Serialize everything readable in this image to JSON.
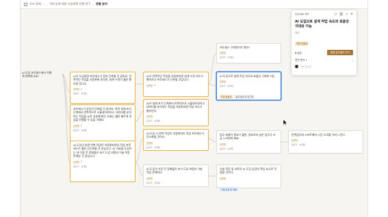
{
  "topbar": {
    "crumbs": [
      "조코 설계 ...",
      "AI도입에 대한 사업계획 진행 연구",
      "병렬 분석"
    ]
  },
  "nodes": {
    "n_left_cut": {
      "text": "AI 도입 프로세스에서 어떻\n게 변화하나요?"
    },
    "n1": {
      "text": "AI가 도입되면 프로세스가 점차 단축될 것 같아요. 반복적인 작업을 자동화해 준다면, 설계 수정이 훨씬 빨라질 겁니다.",
      "meta_a": "답변함",
      "meta_b": "2",
      "author": "응답자 · 설계팀"
    },
    "n2": {
      "text": "AI가 반복적인 작업을 자동화하면 설계 수정 속도가 빨라지고 프로세스가 단축될 것입니다.",
      "meta_a": "답변함",
      "meta_b": "2",
      "author": "응답자 · 설계팀"
    },
    "n3": {
      "text": "프로세스 구체적으로 뭐야?",
      "meta_a": "답변함",
      "author": "응답자 · 설계팀"
    },
    "n4": {
      "text": "AI 도입으로 설계 작업 속도와 효율성 극대화 가능",
      "meta_a": "답변함",
      "author": "응답자 · 설계팀",
      "chips": [
        "작업 효율성",
        "설계 변경 및 피드백"
      ]
    },
    "n5": {
      "text": "프로세스가 상당히 단축될 것 같아요. 특히 설계 초기 단계에서 반복적으로 시뮬레이션하고, 데이터를 분석하는 작업을 AI로 자동화하면, 지표는 훨씬 빠르게 작업을 진행할 수 있을 거예요.",
      "meta_a": "답변함",
      "meta_b": "2",
      "author": "응답자 · 설계팀"
    },
    "n6": {
      "text": "AI가 설계 초기 단계에서 반복적으로 시뮬레이션하고 데이터를 분석하는 작업을 자동화하면 작업 속도가 빨라진다.",
      "meta_a": "답변함",
      "author": "응답자 · 설계팀"
    },
    "n7": {
      "text": "AI 도입이 되면 반복 작업이 자동화되면서 작업 프로세스가 훨씬 간소화될 것 같습니다. AI 기술을 도입하는 데 가장 큰 장애물은 초기 도입 비용과 기술 적응 문제일 것 같습니다.",
      "meta_a": "답변함",
      "meta_b": "2",
      "author": "응답자 · 설계팀"
    },
    "n8": {
      "text": "AI 도입 시 반복 작업이 자동화되어 작업 프로세스가 간소화될 것이다.",
      "meta_a": "답변함",
      "author": "응답자 · 설계팀"
    },
    "n9": {
      "text": "업무 흐름이 필요가 줄면, 중요하지 않은 업무가 조금 느려지게 돼요.",
      "meta_a": "답변함",
      "author": "응답자 · 설계팀"
    },
    "n10": {
      "text": "반복업무에 소프트웨어 시간 소모를 가져 느린다.",
      "meta_a": "답변함",
      "author": "응답자 · 설계팀"
    },
    "n11": {
      "text": "AI 도입의 가장 큰 장애물은 초기 도입 비용과 기술 적응 문제이다.",
      "meta_a": "답변함",
      "author": "응답자 · 설계팀"
    },
    "n12": {
      "text": "기술 적응 및 교육이 AI 도입 성공의 핵심 요소로 작용할 것이다.",
      "meta_a": "답변함",
      "author": "응답자 · 설계팀",
      "chips": [
        "기술 도입 및 적응"
      ]
    }
  },
  "panel": {
    "title": "인사이트 보드",
    "question": "AI 도입으로 설계 작업 속도와 효율성 극대화 가능",
    "sub": "제공",
    "tag": "작업 효율성",
    "count": "3",
    "count_label": "답변",
    "action": "병렬 분석에서 보기",
    "related": "연관 문서",
    "related_count": "1",
    "comment_placeholder": "의견 남기기"
  },
  "colors": {
    "gold_border": "#e4b545",
    "selected_border": "#3e80d8",
    "primary_button": "#a8773a"
  }
}
